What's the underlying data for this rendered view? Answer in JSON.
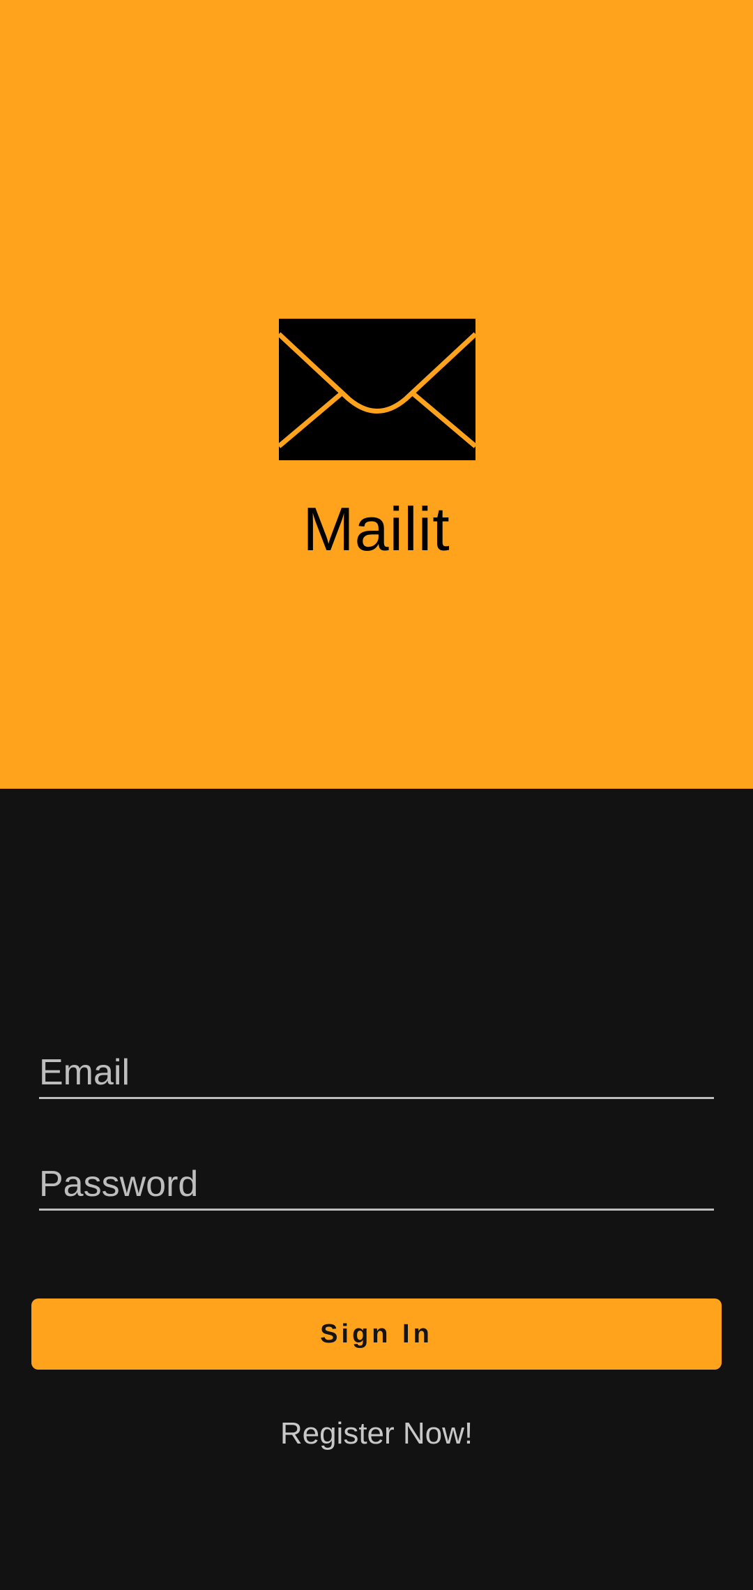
{
  "app": {
    "title": "Mailit",
    "logo_icon": "envelope-icon"
  },
  "colors": {
    "accent": "#FFA31C",
    "background": "#121212",
    "field_underline": "#BDBDBD",
    "placeholder_text": "#BDBDBD"
  },
  "login": {
    "email": {
      "value": "",
      "placeholder": "Email"
    },
    "password": {
      "value": "",
      "placeholder": "Password"
    },
    "sign_in_label": "Sign In",
    "register_label": "Register Now!"
  }
}
